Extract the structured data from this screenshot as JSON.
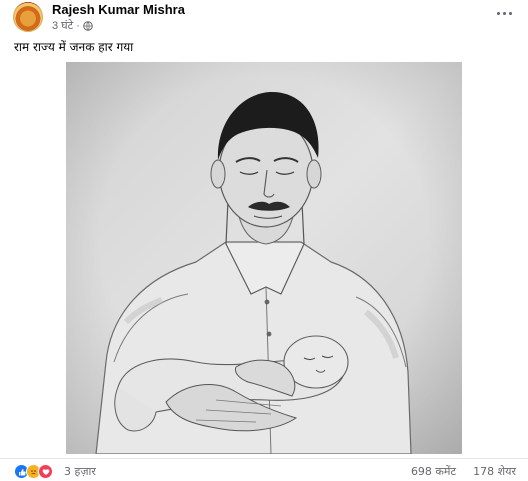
{
  "post": {
    "author": "Rajesh Kumar Mishra",
    "time": "3 घंटे",
    "privacy_icon": "globe-icon",
    "text": "राम राज्य में जनक हार गया"
  },
  "reactions": {
    "icons": [
      "like-icon",
      "sad-icon",
      "love-icon"
    ],
    "count": "3 हज़ार",
    "comments": "698 कमेंट",
    "shares": "178 शेयर"
  },
  "colors": {
    "accent": "#1877f2",
    "secondary_text": "#65676b"
  }
}
